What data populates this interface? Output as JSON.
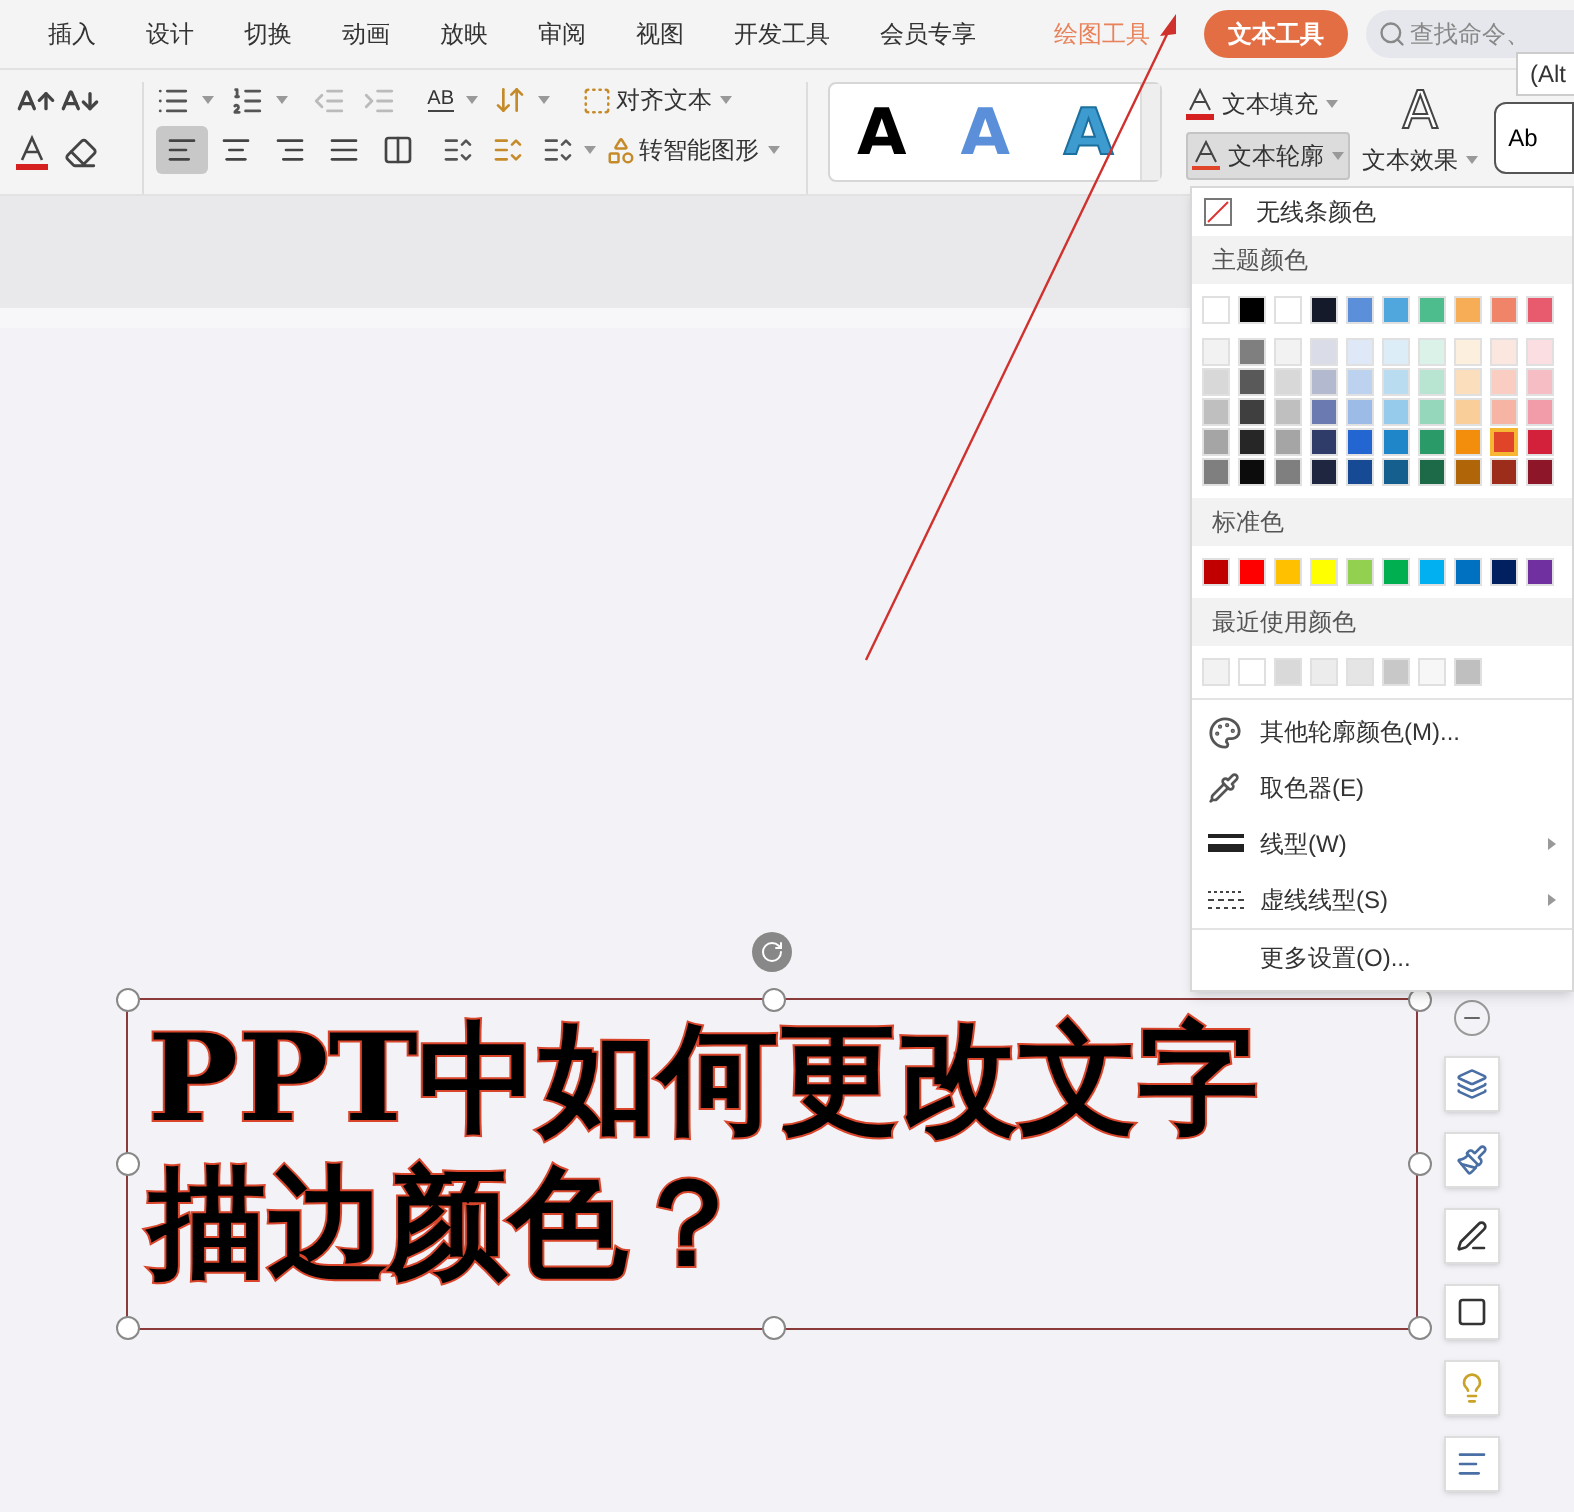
{
  "tabs": [
    {
      "label": "插入",
      "kind": "plain",
      "selected": false
    },
    {
      "label": "设计",
      "kind": "plain",
      "selected": false
    },
    {
      "label": "切换",
      "kind": "plain",
      "selected": false
    },
    {
      "label": "动画",
      "kind": "plain",
      "selected": false
    },
    {
      "label": "放映",
      "kind": "plain",
      "selected": false
    },
    {
      "label": "审阅",
      "kind": "plain",
      "selected": false
    },
    {
      "label": "视图",
      "kind": "plain",
      "selected": false
    },
    {
      "label": "开发工具",
      "kind": "plain",
      "selected": false
    },
    {
      "label": "会员专享",
      "kind": "plain",
      "selected": false
    },
    {
      "label": "绘图工具",
      "kind": "tool",
      "selected": false
    },
    {
      "label": "文本工具",
      "kind": "tool",
      "selected": true
    }
  ],
  "search": {
    "placeholder": "查找命令、"
  },
  "tooltip": "(Alt",
  "ribbon": {
    "ab_label": "AB",
    "align_text": "对齐文本",
    "smart_art": "转智能图形",
    "alignment": [
      {
        "kind": "left",
        "selected": true
      },
      {
        "kind": "center",
        "selected": false
      },
      {
        "kind": "right",
        "selected": false
      },
      {
        "kind": "justify",
        "selected": false
      },
      {
        "kind": "distributed",
        "selected": false
      }
    ],
    "styles": [
      {
        "letter": "A",
        "kind": "solid"
      },
      {
        "letter": "A",
        "kind": "blue"
      },
      {
        "letter": "A",
        "kind": "outline"
      }
    ],
    "text_fill": "文本填充",
    "text_outline": {
      "label": "文本轮廓",
      "pressed": true
    },
    "text_effect": {
      "letter": "A",
      "label": "文本效果"
    },
    "style_box": "Ab"
  },
  "outline_menu": {
    "no_line": "无线条颜色",
    "theme_heading": "主题颜色",
    "theme_colors": [
      {
        "color": "#ffffff",
        "selected": false
      },
      {
        "color": "#000000",
        "selected": false
      },
      {
        "color": "#ffffff",
        "selected": false
      },
      {
        "color": "#141a2a",
        "selected": false
      },
      {
        "color": "#5b8fd9",
        "selected": false
      },
      {
        "color": "#4fa7dd",
        "selected": false
      },
      {
        "color": "#4dbd8d",
        "selected": false
      },
      {
        "color": "#f7ad55",
        "selected": false
      },
      {
        "color": "#ef8468",
        "selected": false
      },
      {
        "color": "#e85a6e",
        "selected": false
      }
    ],
    "shades": [
      [
        {
          "color": "#f2f2f2",
          "selected": false
        },
        {
          "color": "#7f7f7f",
          "selected": false
        },
        {
          "color": "#f2f2f2",
          "selected": false
        },
        {
          "color": "#dadde8",
          "selected": false
        },
        {
          "color": "#dee8f7",
          "selected": false
        },
        {
          "color": "#dcedf8",
          "selected": false
        },
        {
          "color": "#dbf2e8",
          "selected": false
        },
        {
          "color": "#fdefdd",
          "selected": false
        },
        {
          "color": "#fce6e0",
          "selected": false
        },
        {
          "color": "#fadee2",
          "selected": false
        }
      ],
      [
        {
          "color": "#d8d8d8",
          "selected": false
        },
        {
          "color": "#595959",
          "selected": false
        },
        {
          "color": "#d8d8d8",
          "selected": false
        },
        {
          "color": "#b3b9cf",
          "selected": false
        },
        {
          "color": "#bdd2ef",
          "selected": false
        },
        {
          "color": "#b9dcf1",
          "selected": false
        },
        {
          "color": "#b8e5d1",
          "selected": false
        },
        {
          "color": "#fbdebb",
          "selected": false
        },
        {
          "color": "#f9cdc2",
          "selected": false
        },
        {
          "color": "#f6bdc5",
          "selected": false
        }
      ],
      [
        {
          "color": "#bfbfbf",
          "selected": false
        },
        {
          "color": "#3f3f3f",
          "selected": false
        },
        {
          "color": "#bfbfbf",
          "selected": false
        },
        {
          "color": "#6b7bb2",
          "selected": false
        },
        {
          "color": "#9cbce7",
          "selected": false
        },
        {
          "color": "#96cbeb",
          "selected": false
        },
        {
          "color": "#94d7ba",
          "selected": false
        },
        {
          "color": "#f9ce99",
          "selected": false
        },
        {
          "color": "#f5b4a4",
          "selected": false
        },
        {
          "color": "#f19ca8",
          "selected": false
        }
      ],
      [
        {
          "color": "#a5a5a5",
          "selected": false
        },
        {
          "color": "#262626",
          "selected": false
        },
        {
          "color": "#a5a5a5",
          "selected": false
        },
        {
          "color": "#2f3c6a",
          "selected": false
        },
        {
          "color": "#2366d1",
          "selected": false
        },
        {
          "color": "#1f87c9",
          "selected": false
        },
        {
          "color": "#2b9a69",
          "selected": false
        },
        {
          "color": "#f38d0c",
          "selected": false
        },
        {
          "color": "#e0452a",
          "selected": true
        },
        {
          "color": "#d4213b",
          "selected": false
        }
      ],
      [
        {
          "color": "#7f7f7f",
          "selected": false
        },
        {
          "color": "#0c0c0c",
          "selected": false
        },
        {
          "color": "#7f7f7f",
          "selected": false
        },
        {
          "color": "#1f2640",
          "selected": false
        },
        {
          "color": "#174a95",
          "selected": false
        },
        {
          "color": "#155f8f",
          "selected": false
        },
        {
          "color": "#1d6a48",
          "selected": false
        },
        {
          "color": "#b06508",
          "selected": false
        },
        {
          "color": "#9c2d1a",
          "selected": false
        },
        {
          "color": "#8d1628",
          "selected": false
        }
      ]
    ],
    "standard_heading": "标准色",
    "standard_colors": [
      {
        "color": "#c00000",
        "selected": false
      },
      {
        "color": "#ff0000",
        "selected": false
      },
      {
        "color": "#ffc000",
        "selected": false
      },
      {
        "color": "#ffff00",
        "selected": false
      },
      {
        "color": "#92d050",
        "selected": false
      },
      {
        "color": "#00b050",
        "selected": false
      },
      {
        "color": "#00b0f0",
        "selected": false
      },
      {
        "color": "#0070c0",
        "selected": false
      },
      {
        "color": "#002060",
        "selected": false
      },
      {
        "color": "#7030a0",
        "selected": false
      }
    ],
    "recent_heading": "最近使用颜色",
    "recent_colors": [
      {
        "color": "#f2f2f2",
        "selected": false
      },
      {
        "color": "#ffffff",
        "selected": false
      },
      {
        "color": "#d9d9d9",
        "selected": false
      },
      {
        "color": "#ececec",
        "selected": false
      },
      {
        "color": "#e5e5e5",
        "selected": false
      },
      {
        "color": "#c8c8c8",
        "selected": false
      },
      {
        "color": "#f7f7f7",
        "selected": false
      },
      {
        "color": "#bfbfbf",
        "selected": false
      }
    ],
    "items": [
      {
        "kind": "palette",
        "label": "其他轮廓颜色(M)...",
        "submenu": false
      },
      {
        "kind": "eyedropper",
        "label": "取色器(E)",
        "submenu": false
      },
      {
        "kind": "line",
        "label": "线型(W)",
        "submenu": true
      },
      {
        "kind": "dash",
        "label": "虚线线型(S)",
        "submenu": true
      },
      {
        "kind": "more",
        "label": "更多设置(O)...",
        "submenu": false
      }
    ]
  },
  "slide": {
    "title_lines": [
      "PPT中如何更改文字",
      "描边颜色？"
    ]
  }
}
